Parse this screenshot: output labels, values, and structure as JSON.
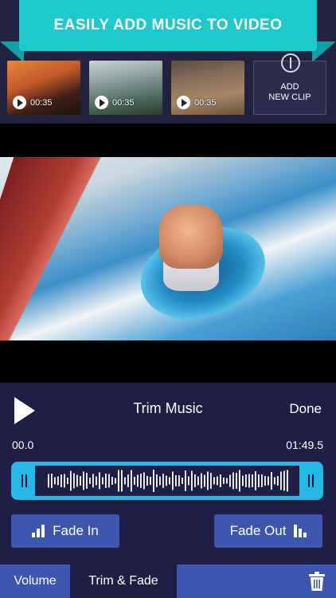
{
  "banner": {
    "title": "EASILY ADD MUSIC TO VIDEO"
  },
  "clips": [
    {
      "duration": "00:35"
    },
    {
      "duration": "00:35"
    },
    {
      "duration": "00:35"
    }
  ],
  "add_clip": {
    "line1": "ADD",
    "line2": "NEW CLIP"
  },
  "trim": {
    "title": "Trim Music",
    "done_label": "Done",
    "start_time": "00.0",
    "end_time": "01:49.5"
  },
  "fade": {
    "in_label": "Fade In",
    "out_label": "Fade Out"
  },
  "tabs": [
    {
      "label": "Volume"
    },
    {
      "label": "Trim & Fade"
    }
  ],
  "colors": {
    "background": "#1f1e45",
    "accent_cyan": "#1ec9cc",
    "waveform_frame": "#22b9e6",
    "button_blue": "#3d56b0"
  },
  "icons": [
    "play-icon",
    "plus-icon",
    "fade-in-icon",
    "fade-out-icon",
    "trash-icon"
  ]
}
